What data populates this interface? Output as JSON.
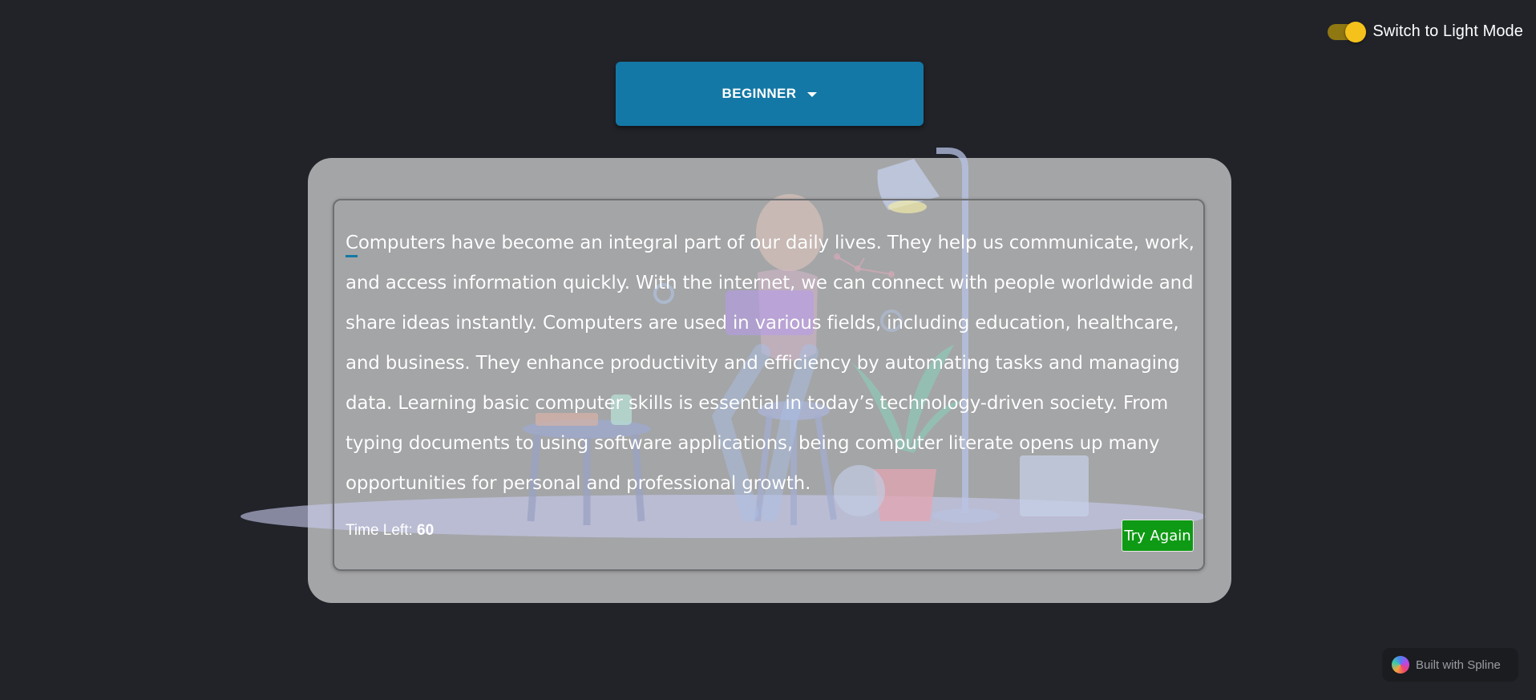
{
  "theme_toggle": {
    "label": "Switch to Light Mode"
  },
  "level_dropdown": {
    "selected": "BEGINNER"
  },
  "typing_test": {
    "passage": "Computers have become an integral part of our daily lives. They help us communicate, work, and access information quickly. With the internet, we can connect with people worldwide and share ideas instantly. Computers are used in various fields, including education, healthcare, and business. They enhance productivity and efficiency by automating tasks and managing data. Learning basic computer skills is essential in today’s technology-driven society. From typing documents to using software applications, being computer literate opens up many opportunities for personal and professional growth.",
    "timer_label": "Time Left:",
    "timer_value": "60",
    "try_again_label": "Try Again"
  },
  "spline_badge": {
    "label": "Built with Spline"
  },
  "colors": {
    "background": "#212329",
    "accent": "#1478a6",
    "card": "#a4a5a7",
    "try_again": "#0e9a14",
    "toggle_knob": "#f5c21b"
  }
}
